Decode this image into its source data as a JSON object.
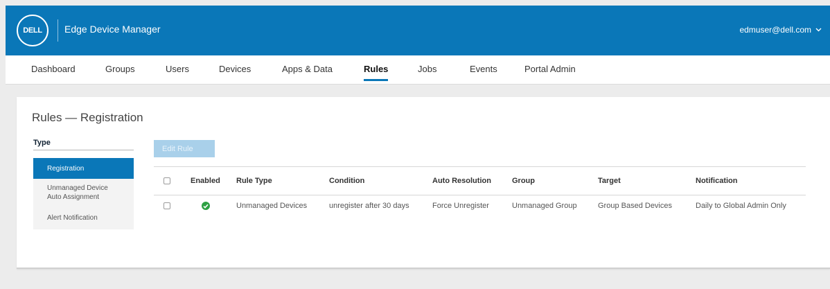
{
  "header": {
    "logo_text": "DELL",
    "app_title": "Edge Device Manager",
    "user": "edmuser@dell.com"
  },
  "nav": {
    "items": [
      {
        "label": "Dashboard"
      },
      {
        "label": "Groups"
      },
      {
        "label": "Users"
      },
      {
        "label": "Devices"
      },
      {
        "label": "Apps & Data"
      },
      {
        "label": "Rules"
      },
      {
        "label": "Jobs"
      },
      {
        "label": "Events"
      },
      {
        "label": "Portal Admin"
      }
    ],
    "active": "Rules"
  },
  "page": {
    "title": "Rules — Registration",
    "type_label": "Type",
    "edit_button": "Edit Rule"
  },
  "sidebar": {
    "items": [
      {
        "label": "Registration",
        "active": true
      },
      {
        "label": "Unmanaged Device Auto Assignment",
        "active": false
      },
      {
        "label": "Alert Notification",
        "active": false
      }
    ]
  },
  "table": {
    "columns": [
      "Enabled",
      "Rule Type",
      "Condition",
      "Auto Resolution",
      "Group",
      "Target",
      "Notification"
    ],
    "rows": [
      {
        "enabled": true,
        "rule_type": "Unmanaged Devices",
        "condition": "unregister after 30 days",
        "auto_resolution": "Force Unregister",
        "group": "Unmanaged Group",
        "target": "Group Based Devices",
        "notification": "Daily to Global Admin Only"
      }
    ]
  },
  "colors": {
    "brand": "#0a77b8",
    "enabled": "#2ea043"
  }
}
